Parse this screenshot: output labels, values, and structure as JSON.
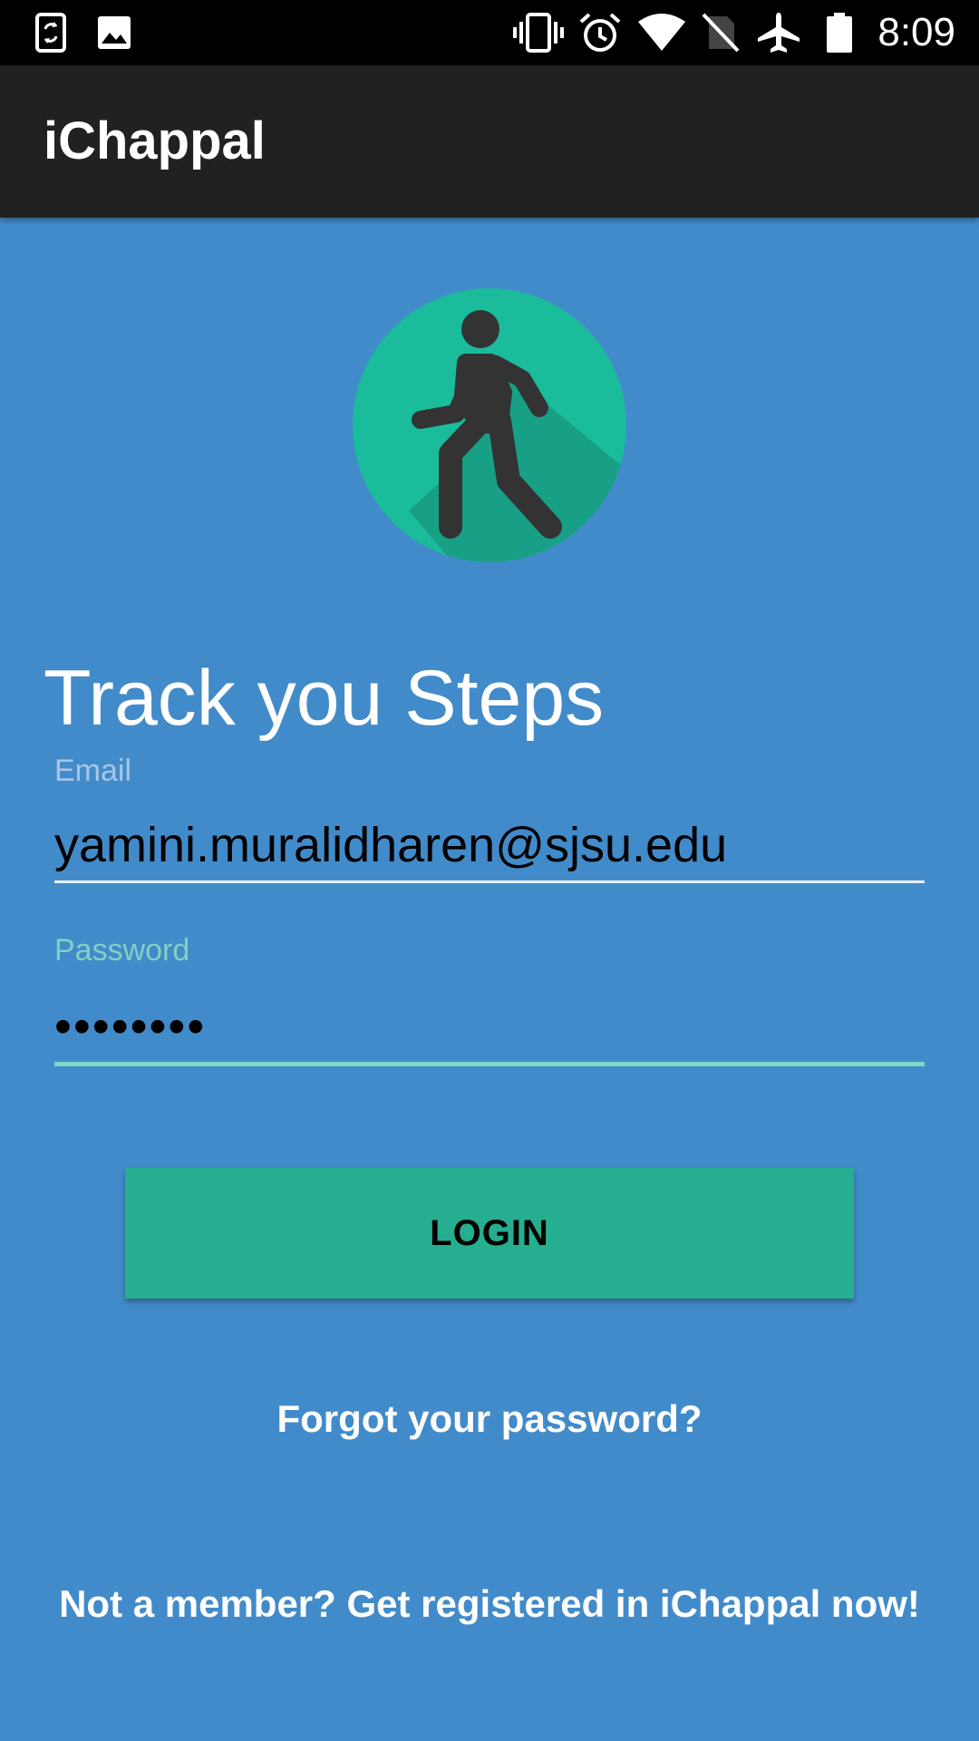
{
  "status_bar": {
    "time": "8:09",
    "icons": [
      "phone-sync-icon",
      "image-icon",
      "vibrate-icon",
      "alarm-icon",
      "wifi-icon",
      "no-sim-icon",
      "airplane-mode-icon",
      "battery-icon"
    ]
  },
  "app_bar": {
    "title": "iChappal"
  },
  "logo": {
    "icon": "walking-person-icon",
    "circle_color": "#1abc9c",
    "figure_color": "#333333"
  },
  "headline": "Track you Steps",
  "email": {
    "label": "Email",
    "value": "yamini.muralidharen@sjsu.edu"
  },
  "password": {
    "label": "Password",
    "value": "••••••••"
  },
  "login_button": {
    "label": "LOGIN"
  },
  "forgot_link": "Forgot your password?",
  "register_link": "Not a member? Get registered in iChappal now!",
  "colors": {
    "background": "#428bca",
    "app_bar": "#212121",
    "accent": "#25ae8f",
    "focused_field": "#80d6c8"
  }
}
